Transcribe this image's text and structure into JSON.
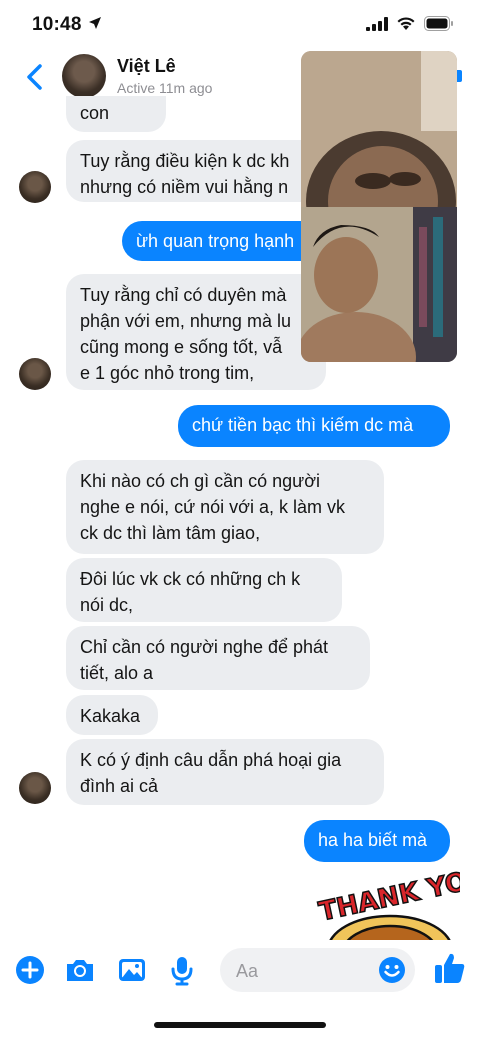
{
  "status_bar": {
    "time": "10:48"
  },
  "header": {
    "contact_name": "Việt Lê",
    "active_status": "Active 11m ago"
  },
  "messages": [
    {
      "dir": "in",
      "text": "con"
    },
    {
      "dir": "in",
      "text": "Tuy rằng điều kiện k dc kh\nnhưng có niềm vui hằng n"
    },
    {
      "dir": "out",
      "text": "ừh quan trọng hạnh"
    },
    {
      "dir": "in",
      "text": "Tuy rằng chỉ có duyên mà\nphận với em, nhưng mà lu\ncũng mong e sống tốt, vẫ\ne 1 góc nhỏ trong tim,"
    },
    {
      "dir": "out",
      "text": "chứ tiền bạc thì kiếm dc mà"
    },
    {
      "dir": "in",
      "text": "Khi nào có ch gì cần có người\nnghe e nói, cứ nói với a, k làm vk\nck dc thì làm tâm giao,"
    },
    {
      "dir": "in",
      "text": "Đôi lúc vk ck có những ch k\nnói dc,"
    },
    {
      "dir": "in",
      "text": "Chỉ cần có người nghe để phát\ntiết, alo a"
    },
    {
      "dir": "in",
      "text": "Kakaka"
    },
    {
      "dir": "in",
      "text": "K có ý định câu dẫn phá hoại gia\nđình ai cả"
    },
    {
      "dir": "out",
      "text": "ha ha biết mà"
    }
  ],
  "sticker": {
    "text": "THANK YOU"
  },
  "composer": {
    "placeholder": "Aa"
  },
  "colors": {
    "accent": "#0a84ff",
    "incoming_bubble": "#ebedf0",
    "sticker_red": "#d9262b"
  },
  "icons": [
    "location-arrow-icon",
    "signal-icon",
    "wifi-icon",
    "battery-icon",
    "back-chevron-icon",
    "plus-icon",
    "camera-icon",
    "gallery-icon",
    "microphone-icon",
    "emoji-icon",
    "thumbs-up-icon"
  ]
}
